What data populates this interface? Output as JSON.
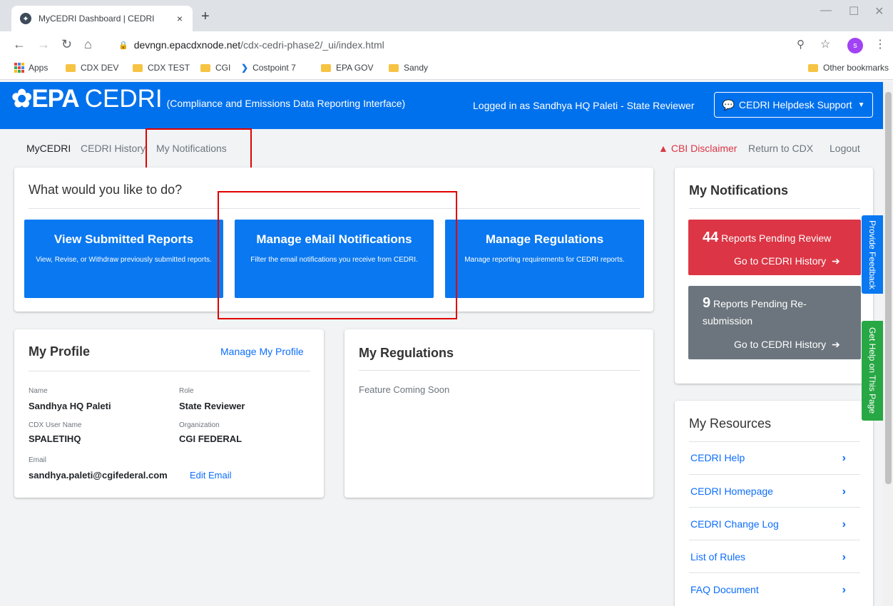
{
  "browser": {
    "tab_title": "MyCEDRI Dashboard | CEDRI",
    "tab_close": "×",
    "new_tab": "+",
    "url_host": "devngn.epacdxnode.net",
    "url_path": "/cdx-cedri-phase2/_ui/index.html",
    "profile_initial": "s",
    "bookmarks": [
      "Apps",
      "CDX DEV",
      "CDX TEST",
      "CGI",
      "Costpoint 7",
      "EPA GOV",
      "Sandy"
    ],
    "other_bookmarks": "Other bookmarks"
  },
  "header": {
    "logo_epa": "EPA",
    "logo_cedri": "CEDRI",
    "logo_sub": "(Compliance and Emissions Data Reporting Interface)",
    "logged_in": "Logged in as Sandhya HQ Paleti - State Reviewer",
    "helpdesk": "CEDRI Helpdesk Support"
  },
  "nav": {
    "items": [
      "MyCEDRI",
      "CEDRI History",
      "My Notifications"
    ],
    "cbi": "CBI Disclaimer",
    "return_cdx": "Return to CDX",
    "logout": "Logout"
  },
  "actions": {
    "title": "What would you like to do?",
    "cards": [
      {
        "title": "View Submitted Reports",
        "desc": "View, Revise, or Withdraw previously submitted reports."
      },
      {
        "title": "Manage eMail Notifications",
        "desc": "Filter the email notifications you receive from CEDRI."
      },
      {
        "title": "Manage Regulations",
        "desc": "Manage reporting requirements for CEDRI reports."
      }
    ]
  },
  "profile": {
    "title": "My Profile",
    "manage": "Manage My Profile",
    "name_label": "Name",
    "name": "Sandhya HQ Paleti",
    "role_label": "Role",
    "role": "State Reviewer",
    "user_label": "CDX User Name",
    "user": "SPALETIHQ",
    "org_label": "Organization",
    "org": "CGI FEDERAL",
    "email_label": "Email",
    "email": "sandhya.paleti@cgifederal.com",
    "edit_email": "Edit Email"
  },
  "regulations": {
    "title": "My Regulations",
    "body": "Feature Coming Soon"
  },
  "notifications": {
    "title": "My Notifications",
    "pending_review_count": "44",
    "pending_review_text": "Reports Pending Review",
    "pending_resub_count": "9",
    "pending_resub_text": "Reports Pending Re-submission",
    "go_history": "Go to CEDRI History"
  },
  "resources": {
    "title": "My Resources",
    "items": [
      "CEDRI Help",
      "CEDRI Homepage",
      "CEDRI Change Log",
      "List of Rules",
      "FAQ Document"
    ]
  },
  "side_tabs": {
    "feedback": "Provide Feedback",
    "help": "Get Help on This Page"
  },
  "colors": {
    "brand_blue": "#0071ed",
    "action_blue": "#0a78f0",
    "danger_red": "#dc3545",
    "secondary_gray": "#6c757d",
    "help_green": "#28a745",
    "highlight_red": "#e00000"
  },
  "icons": [
    "epa-logo-icon",
    "lock-icon",
    "zoom-icon",
    "star-icon",
    "menu-dots-icon",
    "apps-grid-icon",
    "folder-icon",
    "chat-icon",
    "warning-icon",
    "arrow-right-icon",
    "chevron-right-icon"
  ]
}
